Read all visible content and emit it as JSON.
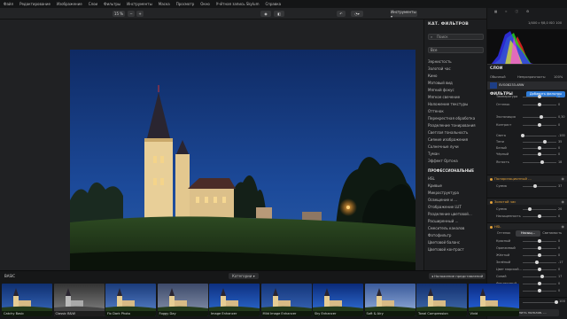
{
  "menubar": [
    "Файл",
    "Редактирование",
    "Изображение",
    "Слои",
    "Фильтры",
    "Инструменты",
    "Маска",
    "Просмотр",
    "Окно",
    "Учётная запись Skylum",
    "Справка"
  ],
  "toolbar": {
    "zoom": "15 %",
    "tools_label": "Инструменты ▾",
    "save_label": "Сохранить",
    "apply_label": "Применить"
  },
  "catalog": {
    "title": "КАТ. ФИЛЬТРОВ",
    "search_placeholder": "Поиск",
    "select_value": "Все",
    "items": [
      "Зернистость",
      "Золотой час",
      "Кино",
      "Матовый вид",
      "Мягкий фокус",
      "Мягкое свечение",
      "Наложение текстуры",
      "Оттенок",
      "Перекрестная обработка",
      "Разделение тонирования",
      "Светлая тональность",
      "Сияние изображения",
      "Солнечные лучи",
      "Туман",
      "Эффект Ортона"
    ],
    "section": "ПРОФЕССИОНАЛЬНЫЕ",
    "pro_items": [
      "HSL",
      "Кривые",
      "Микроструктура",
      "Освещение и ...",
      "Отображение LUT",
      "Разделение цветовой...",
      "Расширенный ...",
      "Смеситель каналов",
      "Фотофильтр",
      "Цветовой баланс",
      "Цветовой контраст"
    ]
  },
  "right_panel": {
    "file_info": "1/400 с  f/8,0  ISO 100",
    "layers_title": "СЛОИ",
    "layer_mode": "Обычный",
    "layer_opacity_label": "Непрозрачность:",
    "layer_opacity": "100%",
    "layer_name": "SVG08233.ARW",
    "filters_title": "ФИЛЬТРЫ",
    "add_filters": "Добавить фильтры",
    "developer": {
      "rows": [
        {
          "label": "Температура",
          "value": "0",
          "pos": 0.5
        },
        {
          "label": "Оттенок",
          "value": "0",
          "pos": 0.5
        },
        {
          "label": "Экспозиция",
          "value": "0,30",
          "pos": 0.56
        },
        {
          "label": "Контраст",
          "value": "0",
          "pos": 0.5
        },
        {
          "label": "Света",
          "value": "-100",
          "pos": 0.0
        },
        {
          "label": "Тени",
          "value": "35",
          "pos": 0.67
        },
        {
          "label": "Белый",
          "value": "0",
          "pos": 0.5
        },
        {
          "label": "Чёрный",
          "value": "0",
          "pos": 0.5
        },
        {
          "label": "Ясность",
          "value": "18",
          "pos": 0.59
        }
      ]
    },
    "sections": [
      "Поляризационный ...",
      "Золотой час",
      "HSL"
    ],
    "polar_strength": {
      "label": "Сумма",
      "value": "37",
      "pos": 0.37
    },
    "golden": [
      {
        "label": "Сумма",
        "value": "20",
        "pos": 0.2
      },
      {
        "label": "Насыщенность",
        "value": "0",
        "pos": 0.5
      }
    ],
    "hsl_tabs": [
      "Оттенок",
      "Насыщ...",
      "Светимость"
    ],
    "hsl_rows": [
      {
        "label": "Красный",
        "value": "0",
        "pos": 0.5
      },
      {
        "label": "Оранжевый",
        "value": "0",
        "pos": 0.5
      },
      {
        "label": "Жёлтый",
        "value": "0",
        "pos": 0.5
      },
      {
        "label": "Зелёный",
        "value": "-17",
        "pos": 0.42
      },
      {
        "label": "Цвет морской...",
        "value": "0",
        "pos": 0.5
      },
      {
        "label": "Синий",
        "value": "17",
        "pos": 0.58
      },
      {
        "label": "Фиолетовый",
        "value": "0",
        "pos": 0.5
      },
      {
        "label": "Пурпурный",
        "value": "0",
        "pos": 0.5
      }
    ],
    "filter_amount": {
      "label": "Сумма фильтра",
      "value": "100"
    },
    "save_preset": "Сохранить пользов. ..."
  },
  "bottom": {
    "category_label": "BASIC",
    "categories_btn": "Категории ▾",
    "hide_btn": "◂ Наложение представлений",
    "presets": [
      "Catchy Basic",
      "Classic B&W",
      "Fix Dark Photo",
      "Foggy Day",
      "Image Enhancer",
      "Mild Image Enhancer",
      "Sky Enhancer",
      "Soft & Airy",
      "Tonal Compression",
      "Vivid"
    ]
  }
}
